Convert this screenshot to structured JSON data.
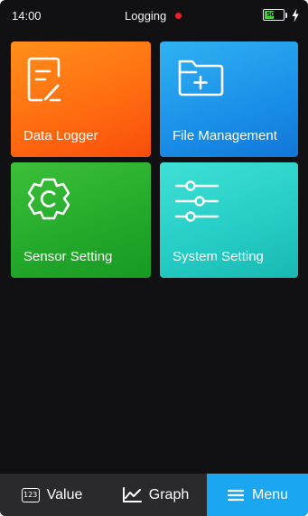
{
  "colors": {
    "screen_background": "#111113",
    "logging_indicator": "#e8212b",
    "battery_fill": "#43d13c",
    "menu_active_background": "#1aa6f0",
    "data_logger_tile": "#ff6a10",
    "file_management_tile": "#1a8fe8",
    "sensor_setting_tile": "#23a82a",
    "system_setting_tile": "#24ccc4"
  },
  "status_bar": {
    "time": "14:00",
    "status_text": "Logging",
    "battery_percent_label": "50%",
    "battery_level": 0.5,
    "charging_icon": "lightning-bolt-icon"
  },
  "tiles": [
    {
      "label": "Data Logger",
      "icon": "edit-document-icon"
    },
    {
      "label": "File Management",
      "icon": "folder-add-icon"
    },
    {
      "label": "Sensor Setting",
      "icon": "gear-icon"
    },
    {
      "label": "System Setting",
      "icon": "sliders-icon"
    }
  ],
  "bottom_nav": {
    "items": [
      {
        "label": "Value",
        "icon": "numeric-123-icon",
        "active": false
      },
      {
        "label": "Graph",
        "icon": "line-chart-icon",
        "active": false
      },
      {
        "label": "Menu",
        "icon": "hamburger-menu-icon",
        "active": true
      }
    ]
  }
}
